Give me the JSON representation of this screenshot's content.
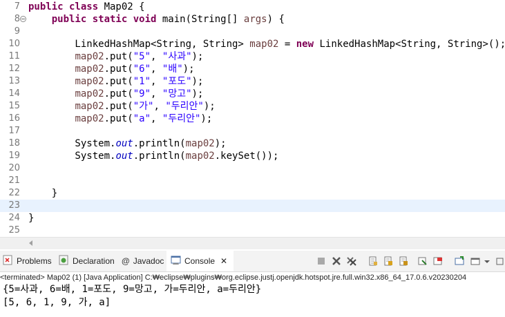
{
  "editor": {
    "lines": [
      {
        "num": "7",
        "fold": false,
        "parts": [
          [
            "kw",
            "public class "
          ],
          [
            "",
            "Map02 {"
          ]
        ]
      },
      {
        "num": "8",
        "fold": true,
        "parts": [
          [
            "",
            "    "
          ],
          [
            "kw",
            "public static void "
          ],
          [
            "",
            "main(String[] "
          ],
          [
            "var",
            "args"
          ],
          [
            "",
            ") {"
          ]
        ]
      },
      {
        "num": "9",
        "fold": false,
        "parts": []
      },
      {
        "num": "10",
        "fold": false,
        "parts": [
          [
            "",
            "        LinkedHashMap<String, String> "
          ],
          [
            "var",
            "map02"
          ],
          [
            "",
            " = "
          ],
          [
            "kw",
            "new"
          ],
          [
            "",
            " LinkedHashMap<String, String>();"
          ]
        ]
      },
      {
        "num": "11",
        "fold": false,
        "parts": [
          [
            "",
            "        "
          ],
          [
            "var",
            "map02"
          ],
          [
            "",
            ".put("
          ],
          [
            "str",
            "\"5\""
          ],
          [
            "",
            ", "
          ],
          [
            "str",
            "\"사과\""
          ],
          [
            "",
            ");"
          ]
        ]
      },
      {
        "num": "12",
        "fold": false,
        "parts": [
          [
            "",
            "        "
          ],
          [
            "var",
            "map02"
          ],
          [
            "",
            ".put("
          ],
          [
            "str",
            "\"6\""
          ],
          [
            "",
            ", "
          ],
          [
            "str",
            "\"배\""
          ],
          [
            "",
            ");"
          ]
        ]
      },
      {
        "num": "13",
        "fold": false,
        "parts": [
          [
            "",
            "        "
          ],
          [
            "var",
            "map02"
          ],
          [
            "",
            ".put("
          ],
          [
            "str",
            "\"1\""
          ],
          [
            "",
            ", "
          ],
          [
            "str",
            "\"포도\""
          ],
          [
            "",
            ");"
          ]
        ]
      },
      {
        "num": "14",
        "fold": false,
        "parts": [
          [
            "",
            "        "
          ],
          [
            "var",
            "map02"
          ],
          [
            "",
            ".put("
          ],
          [
            "str",
            "\"9\""
          ],
          [
            "",
            ", "
          ],
          [
            "str",
            "\"망고\""
          ],
          [
            "",
            ");"
          ]
        ]
      },
      {
        "num": "15",
        "fold": false,
        "parts": [
          [
            "",
            "        "
          ],
          [
            "var",
            "map02"
          ],
          [
            "",
            ".put("
          ],
          [
            "str",
            "\"가\""
          ],
          [
            "",
            ", "
          ],
          [
            "str",
            "\"두리안\""
          ],
          [
            "",
            ");"
          ]
        ]
      },
      {
        "num": "16",
        "fold": false,
        "parts": [
          [
            "",
            "        "
          ],
          [
            "var",
            "map02"
          ],
          [
            "",
            ".put("
          ],
          [
            "str",
            "\"a\""
          ],
          [
            "",
            ", "
          ],
          [
            "str",
            "\"두리안\""
          ],
          [
            "",
            ");"
          ]
        ]
      },
      {
        "num": "17",
        "fold": false,
        "parts": []
      },
      {
        "num": "18",
        "fold": false,
        "parts": [
          [
            "",
            "        System."
          ],
          [
            "fld",
            "out"
          ],
          [
            "",
            ".println("
          ],
          [
            "var",
            "map02"
          ],
          [
            "",
            ");"
          ]
        ]
      },
      {
        "num": "19",
        "fold": false,
        "parts": [
          [
            "",
            "        System."
          ],
          [
            "fld",
            "out"
          ],
          [
            "",
            ".println("
          ],
          [
            "var",
            "map02"
          ],
          [
            "",
            ".keySet());"
          ]
        ]
      },
      {
        "num": "20",
        "fold": false,
        "parts": []
      },
      {
        "num": "21",
        "fold": false,
        "parts": []
      },
      {
        "num": "22",
        "fold": false,
        "parts": [
          [
            "",
            "    }"
          ]
        ]
      },
      {
        "num": "23",
        "fold": false,
        "highlight": true,
        "parts": []
      },
      {
        "num": "24",
        "fold": false,
        "parts": [
          [
            "",
            "}"
          ]
        ]
      },
      {
        "num": "25",
        "fold": false,
        "parts": []
      }
    ]
  },
  "tabs": [
    {
      "label": "Problems",
      "icon": "problems-icon"
    },
    {
      "label": "Declaration",
      "icon": "declaration-icon"
    },
    {
      "label": "Javadoc",
      "icon": "javadoc-icon"
    },
    {
      "label": "Console",
      "icon": "console-icon",
      "active": true
    }
  ],
  "console": {
    "close_glyph": "✕",
    "status": "<terminated> Map02 (1) [Java Application] C:₩eclipse₩plugins₩org.eclipse.justj.openjdk.hotspot.jre.full.win32.x86_64_17.0.6.v20230204",
    "output": [
      "{5=사과, 6=배, 1=포도, 9=망고, 가=두리안, a=두리안}",
      "[5, 6, 1, 9, 가, a]"
    ]
  },
  "toolbar_icons": [
    "terminate-icon",
    "remove-launch-icon",
    "remove-all-terminated-icon",
    "scroll-lock-icon",
    "show-console-on-output-icon",
    "word-wrap-icon",
    "pin-console-icon",
    "display-selected-console-icon",
    "open-console-icon",
    "minimize-icon",
    "maximize-icon"
  ]
}
